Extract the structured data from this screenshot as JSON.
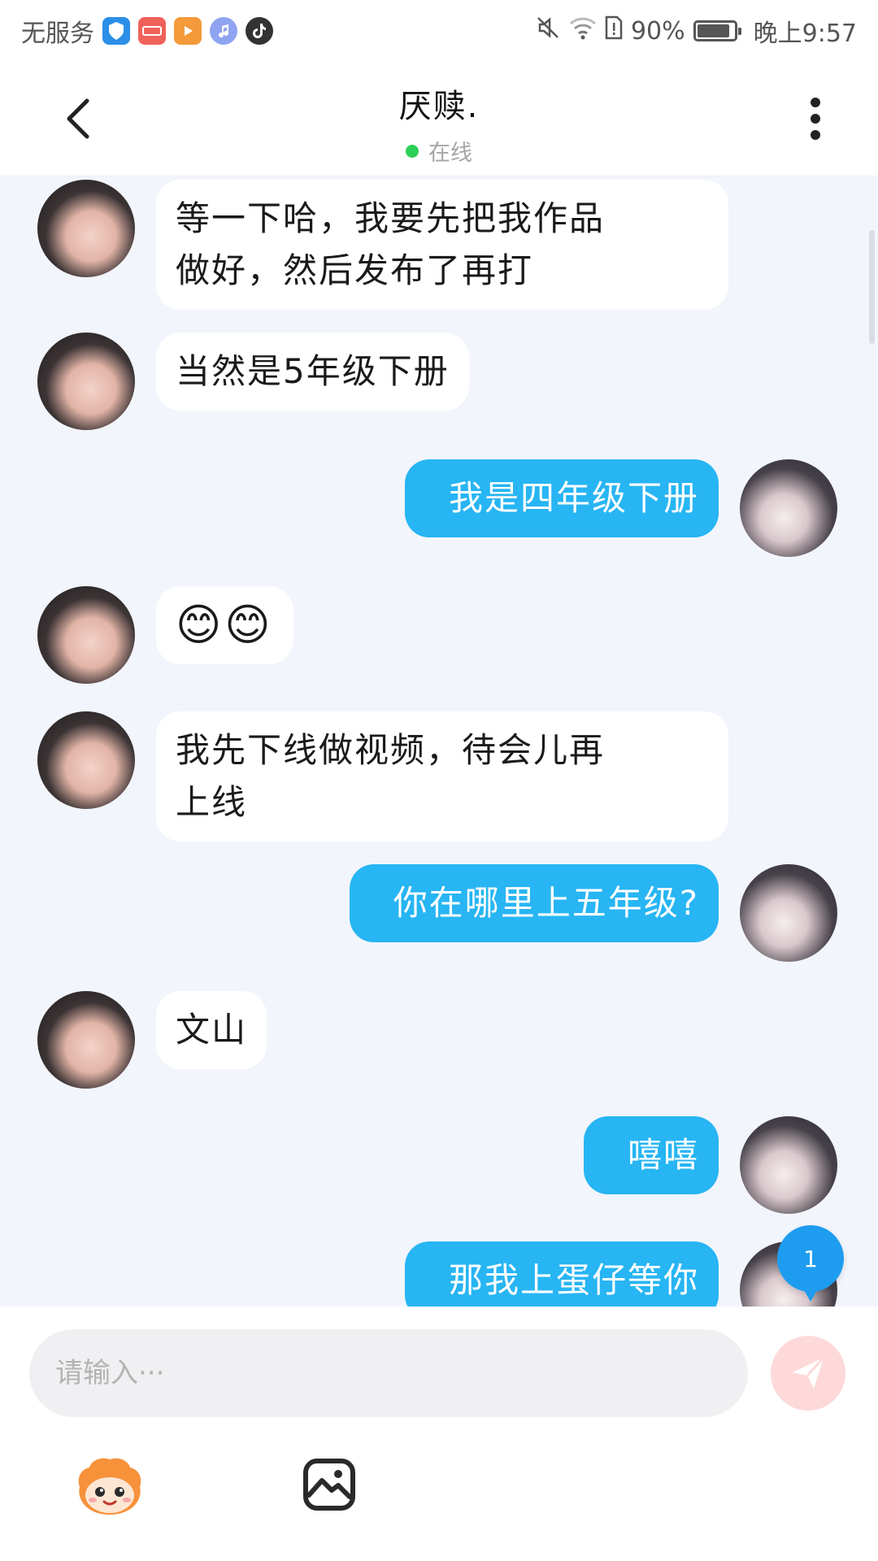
{
  "status_bar": {
    "carrier": "无服务",
    "battery": "90%",
    "battery_level": 0.9,
    "time": "晚上9:57",
    "app_icons": [
      "shield-app-icon",
      "huawei-app-icon",
      "video-app-icon",
      "music-app-icon",
      "tiktok-app-icon"
    ],
    "status_icons": [
      "mute-icon",
      "wifi-icon",
      "sim-alert-icon",
      "battery-icon"
    ]
  },
  "header": {
    "title": "厌赎.",
    "presence": "在线",
    "presence_color": "#2ecf57"
  },
  "messages": [
    {
      "side": "left",
      "text": "等一下哈，我要先把我作品\n做好，然后发布了再打"
    },
    {
      "side": "left",
      "text": "当然是5年级下册"
    },
    {
      "side": "right",
      "text": "我是四年级下册"
    },
    {
      "side": "left",
      "text": "😊😊"
    },
    {
      "side": "left",
      "text": "我先下线做视频，待会儿再\n上线"
    },
    {
      "side": "right",
      "text": "你在哪里上五年级?"
    },
    {
      "side": "left",
      "text": "文山"
    },
    {
      "side": "right",
      "text": "嘻嘻"
    },
    {
      "side": "right",
      "text": "那我上蛋仔等你"
    }
  ],
  "unread_badge": "1",
  "composer": {
    "placeholder": "请输入···",
    "value": "",
    "send_icon": "send-icon",
    "tools": [
      "mascot-icon",
      "image-icon"
    ]
  },
  "colors": {
    "outgoing_bubble": "#27b5f3",
    "incoming_bubble": "#ffffff",
    "chat_background": "#f2f5fb",
    "badge": "#1e9cf0",
    "send_button": "#fdd9d9"
  }
}
